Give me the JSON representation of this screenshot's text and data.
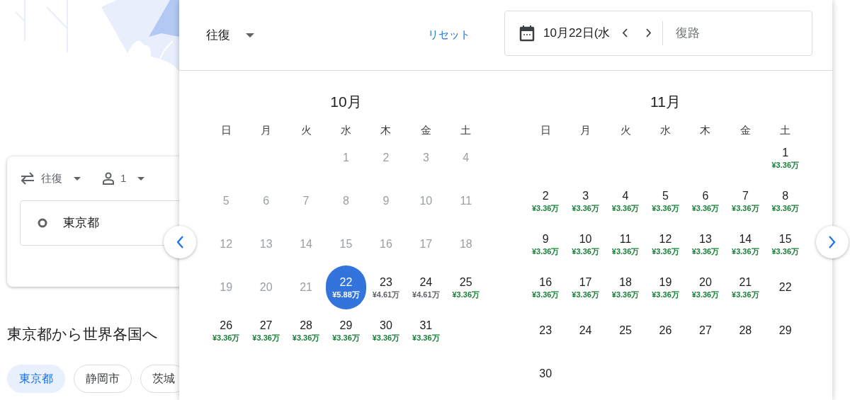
{
  "search_card": {
    "trip_type": "往復",
    "passengers": "1",
    "origin": "東京都"
  },
  "heading": "東京都から世界各国へ",
  "chips": [
    {
      "label": "東京都",
      "selected": true
    },
    {
      "label": "静岡市",
      "selected": false
    },
    {
      "label": "茨城",
      "selected": false
    }
  ],
  "dialog": {
    "trip_type": "往復",
    "reset": "リセット",
    "departure": "10月22日(水",
    "return_placeholder": "復路",
    "months": [
      {
        "title": "10月",
        "weekdays": [
          "日",
          "月",
          "火",
          "水",
          "木",
          "金",
          "土"
        ],
        "weeks": [
          [
            {
              "kind": "blank"
            },
            {
              "kind": "blank"
            },
            {
              "kind": "blank"
            },
            {
              "kind": "past",
              "day": "1"
            },
            {
              "kind": "past",
              "day": "2"
            },
            {
              "kind": "past",
              "day": "3"
            },
            {
              "kind": "past",
              "day": "4"
            }
          ],
          [
            {
              "kind": "past",
              "day": "5"
            },
            {
              "kind": "past",
              "day": "6"
            },
            {
              "kind": "past",
              "day": "7"
            },
            {
              "kind": "past",
              "day": "8"
            },
            {
              "kind": "past",
              "day": "9"
            },
            {
              "kind": "past",
              "day": "10"
            },
            {
              "kind": "past",
              "day": "11"
            }
          ],
          [
            {
              "kind": "past",
              "day": "12"
            },
            {
              "kind": "past",
              "day": "13"
            },
            {
              "kind": "past",
              "day": "14"
            },
            {
              "kind": "past",
              "day": "15"
            },
            {
              "kind": "past",
              "day": "16"
            },
            {
              "kind": "past",
              "day": "17"
            },
            {
              "kind": "past",
              "day": "18"
            }
          ],
          [
            {
              "kind": "past",
              "day": "19"
            },
            {
              "kind": "past",
              "day": "20"
            },
            {
              "kind": "past",
              "day": "21"
            },
            {
              "kind": "day",
              "day": "22",
              "price": "¥5.88万",
              "color": "#ffffff",
              "selected": true
            },
            {
              "kind": "day",
              "day": "23",
              "price": "¥4.61万",
              "color": "#5f6368",
              "selected": false
            },
            {
              "kind": "day",
              "day": "24",
              "price": "¥4.61万",
              "color": "#5f6368",
              "selected": false
            },
            {
              "kind": "day",
              "day": "25",
              "price": "¥3.36万",
              "color": "#188038",
              "selected": false
            }
          ],
          [
            {
              "kind": "day",
              "day": "26",
              "price": "¥3.36万",
              "color": "#188038",
              "selected": false
            },
            {
              "kind": "day",
              "day": "27",
              "price": "¥3.36万",
              "color": "#188038",
              "selected": false
            },
            {
              "kind": "day",
              "day": "28",
              "price": "¥3.36万",
              "color": "#188038",
              "selected": false
            },
            {
              "kind": "day",
              "day": "29",
              "price": "¥3.36万",
              "color": "#188038",
              "selected": false
            },
            {
              "kind": "day",
              "day": "30",
              "price": "¥3.36万",
              "color": "#188038",
              "selected": false
            },
            {
              "kind": "day",
              "day": "31",
              "price": "¥3.36万",
              "color": "#188038",
              "selected": false
            }
          ]
        ]
      },
      {
        "title": "11月",
        "weekdays": [
          "日",
          "月",
          "火",
          "水",
          "木",
          "金",
          "土"
        ],
        "weeks": [
          [
            {
              "kind": "blank"
            },
            {
              "kind": "blank"
            },
            {
              "kind": "blank"
            },
            {
              "kind": "blank"
            },
            {
              "kind": "blank"
            },
            {
              "kind": "blank"
            },
            {
              "kind": "day",
              "day": "1",
              "price": "¥3.36万",
              "color": "#188038",
              "selected": false
            }
          ],
          [
            {
              "kind": "day",
              "day": "2",
              "price": "¥3.36万",
              "color": "#188038",
              "selected": false
            },
            {
              "kind": "day",
              "day": "3",
              "price": "¥3.36万",
              "color": "#188038",
              "selected": false
            },
            {
              "kind": "day",
              "day": "4",
              "price": "¥3.36万",
              "color": "#188038",
              "selected": false
            },
            {
              "kind": "day",
              "day": "5",
              "price": "¥3.36万",
              "color": "#188038",
              "selected": false
            },
            {
              "kind": "day",
              "day": "6",
              "price": "¥3.36万",
              "color": "#188038",
              "selected": false
            },
            {
              "kind": "day",
              "day": "7",
              "price": "¥3.36万",
              "color": "#188038",
              "selected": false
            },
            {
              "kind": "day",
              "day": "8",
              "price": "¥3.36万",
              "color": "#188038",
              "selected": false
            }
          ],
          [
            {
              "kind": "day",
              "day": "9",
              "price": "¥3.36万",
              "color": "#188038",
              "selected": false
            },
            {
              "kind": "day",
              "day": "10",
              "price": "¥3.36万",
              "color": "#188038",
              "selected": false
            },
            {
              "kind": "day",
              "day": "11",
              "price": "¥3.36万",
              "color": "#188038",
              "selected": false
            },
            {
              "kind": "day",
              "day": "12",
              "price": "¥3.36万",
              "color": "#188038",
              "selected": false
            },
            {
              "kind": "day",
              "day": "13",
              "price": "¥3.36万",
              "color": "#188038",
              "selected": false
            },
            {
              "kind": "day",
              "day": "14",
              "price": "¥3.36万",
              "color": "#188038",
              "selected": false
            },
            {
              "kind": "day",
              "day": "15",
              "price": "¥3.36万",
              "color": "#188038",
              "selected": false
            }
          ],
          [
            {
              "kind": "day",
              "day": "16",
              "price": "¥3.36万",
              "color": "#188038",
              "selected": false
            },
            {
              "kind": "day",
              "day": "17",
              "price": "¥3.36万",
              "color": "#188038",
              "selected": false
            },
            {
              "kind": "day",
              "day": "18",
              "price": "¥3.36万",
              "color": "#188038",
              "selected": false
            },
            {
              "kind": "day",
              "day": "19",
              "price": "¥3.36万",
              "color": "#188038",
              "selected": false
            },
            {
              "kind": "day",
              "day": "20",
              "price": "¥3.36万",
              "color": "#188038",
              "selected": false
            },
            {
              "kind": "day",
              "day": "21",
              "price": "¥3.36万",
              "color": "#188038",
              "selected": false
            },
            {
              "kind": "day",
              "day": "22",
              "selected": false
            }
          ],
          [
            {
              "kind": "day",
              "day": "23",
              "selected": false
            },
            {
              "kind": "day",
              "day": "24",
              "selected": false
            },
            {
              "kind": "day",
              "day": "25",
              "selected": false
            },
            {
              "kind": "day",
              "day": "26",
              "selected": false
            },
            {
              "kind": "day",
              "day": "27",
              "selected": false
            },
            {
              "kind": "day",
              "day": "28",
              "selected": false
            },
            {
              "kind": "day",
              "day": "29",
              "selected": false
            }
          ],
          [
            {
              "kind": "day",
              "day": "30",
              "selected": false
            }
          ]
        ]
      }
    ]
  }
}
